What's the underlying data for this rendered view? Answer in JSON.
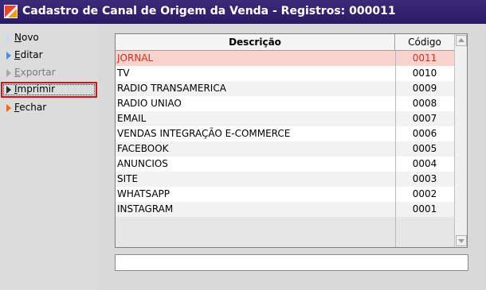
{
  "window": {
    "title": "Cadastro de Canal de Origem da Venda - Registros: 000011"
  },
  "sidebar": {
    "items": [
      {
        "label": "Novo",
        "accel": "N",
        "rest": "ovo",
        "arrow_color": "#c8d8f0"
      },
      {
        "label": "Editar",
        "accel": "E",
        "rest": "ditar",
        "arrow_color": "#4a90d9"
      },
      {
        "label": "Exportar",
        "accel": "E",
        "rest": "xportar",
        "arrow_color": "#a8a8a8",
        "disabled": true
      },
      {
        "label": "Imprimir",
        "accel": "I",
        "rest": "mprimir",
        "arrow_color": "#2b2b2b",
        "selected": true
      },
      {
        "label": "Fechar",
        "accel": "F",
        "rest": "echar",
        "arrow_color": "#e86a1a"
      }
    ]
  },
  "grid": {
    "columns": [
      "Descrição",
      "Código"
    ],
    "rows": [
      {
        "descricao": "JORNAL",
        "codigo": "0011",
        "selected": true
      },
      {
        "descricao": "TV",
        "codigo": "0010"
      },
      {
        "descricao": "RADIO TRANSAMERICA",
        "codigo": "0009"
      },
      {
        "descricao": "RADIO UNIAO",
        "codigo": "0008"
      },
      {
        "descricao": "EMAIL",
        "codigo": "0007"
      },
      {
        "descricao": "VENDAS INTEGRAÇÃO E-COMMERCE",
        "codigo": "0006"
      },
      {
        "descricao": "FACEBOOK",
        "codigo": "0005"
      },
      {
        "descricao": "ANUNCIOS",
        "codigo": "0004"
      },
      {
        "descricao": "SITE",
        "codigo": "0003"
      },
      {
        "descricao": "WHATSAPP",
        "codigo": "0002"
      },
      {
        "descricao": "INSTAGRAM",
        "codigo": "0001"
      }
    ]
  },
  "status_box": {
    "value": ""
  },
  "icons": {
    "app": "app-logo-icon",
    "scroll_up": "scroll-up-arrow-icon",
    "scroll_down": "scroll-down-arrow-icon"
  },
  "colors": {
    "titlebar": "#2e1d69",
    "selected_row_bg": "#f8d3cd",
    "selected_row_text": "#c8321c",
    "selection_border": "#d4121a"
  }
}
